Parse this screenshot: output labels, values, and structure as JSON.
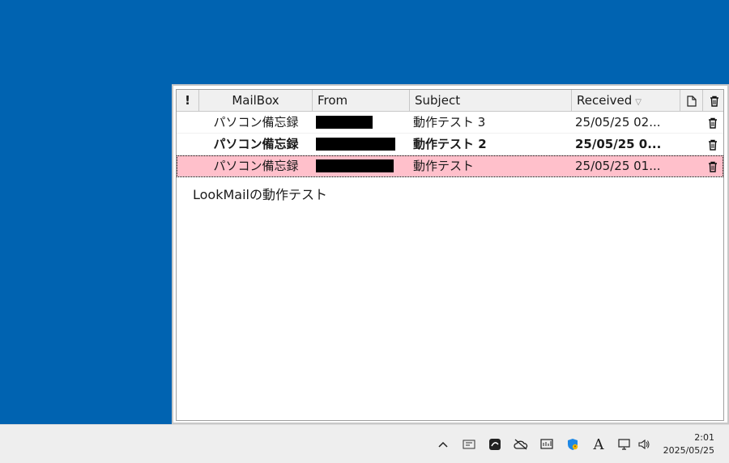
{
  "mail": {
    "columns": {
      "flag": "!",
      "mailbox": "MailBox",
      "from": "From",
      "subject": "Subject",
      "received": "Received"
    },
    "rows": [
      {
        "mailbox": "パソコン備忘録",
        "subject": "動作テスト 3",
        "received": "25/05/25 02...",
        "bold": false,
        "selected": false
      },
      {
        "mailbox": "パソコン備忘録",
        "subject": "動作テスト 2",
        "received": "25/05/25 0...",
        "bold": true,
        "selected": false
      },
      {
        "mailbox": "パソコン備忘録",
        "subject": "動作テスト",
        "received": "25/05/25 01...",
        "bold": false,
        "selected": true
      }
    ],
    "preview": "LookMailの動作テスト",
    "selected_row_color": "#ffc0cb"
  },
  "taskbar": {
    "icons": [
      "chevron-up-icon",
      "keyboard-ime-icon",
      "app-tray-icon",
      "onedrive-icon",
      "network-icon",
      "security-icon",
      "font-a-icon",
      "display-icon",
      "speaker-icon"
    ],
    "clock_time": "2:01",
    "clock_date": "2025/05/25"
  },
  "colors": {
    "desktop": "#0063b1"
  }
}
